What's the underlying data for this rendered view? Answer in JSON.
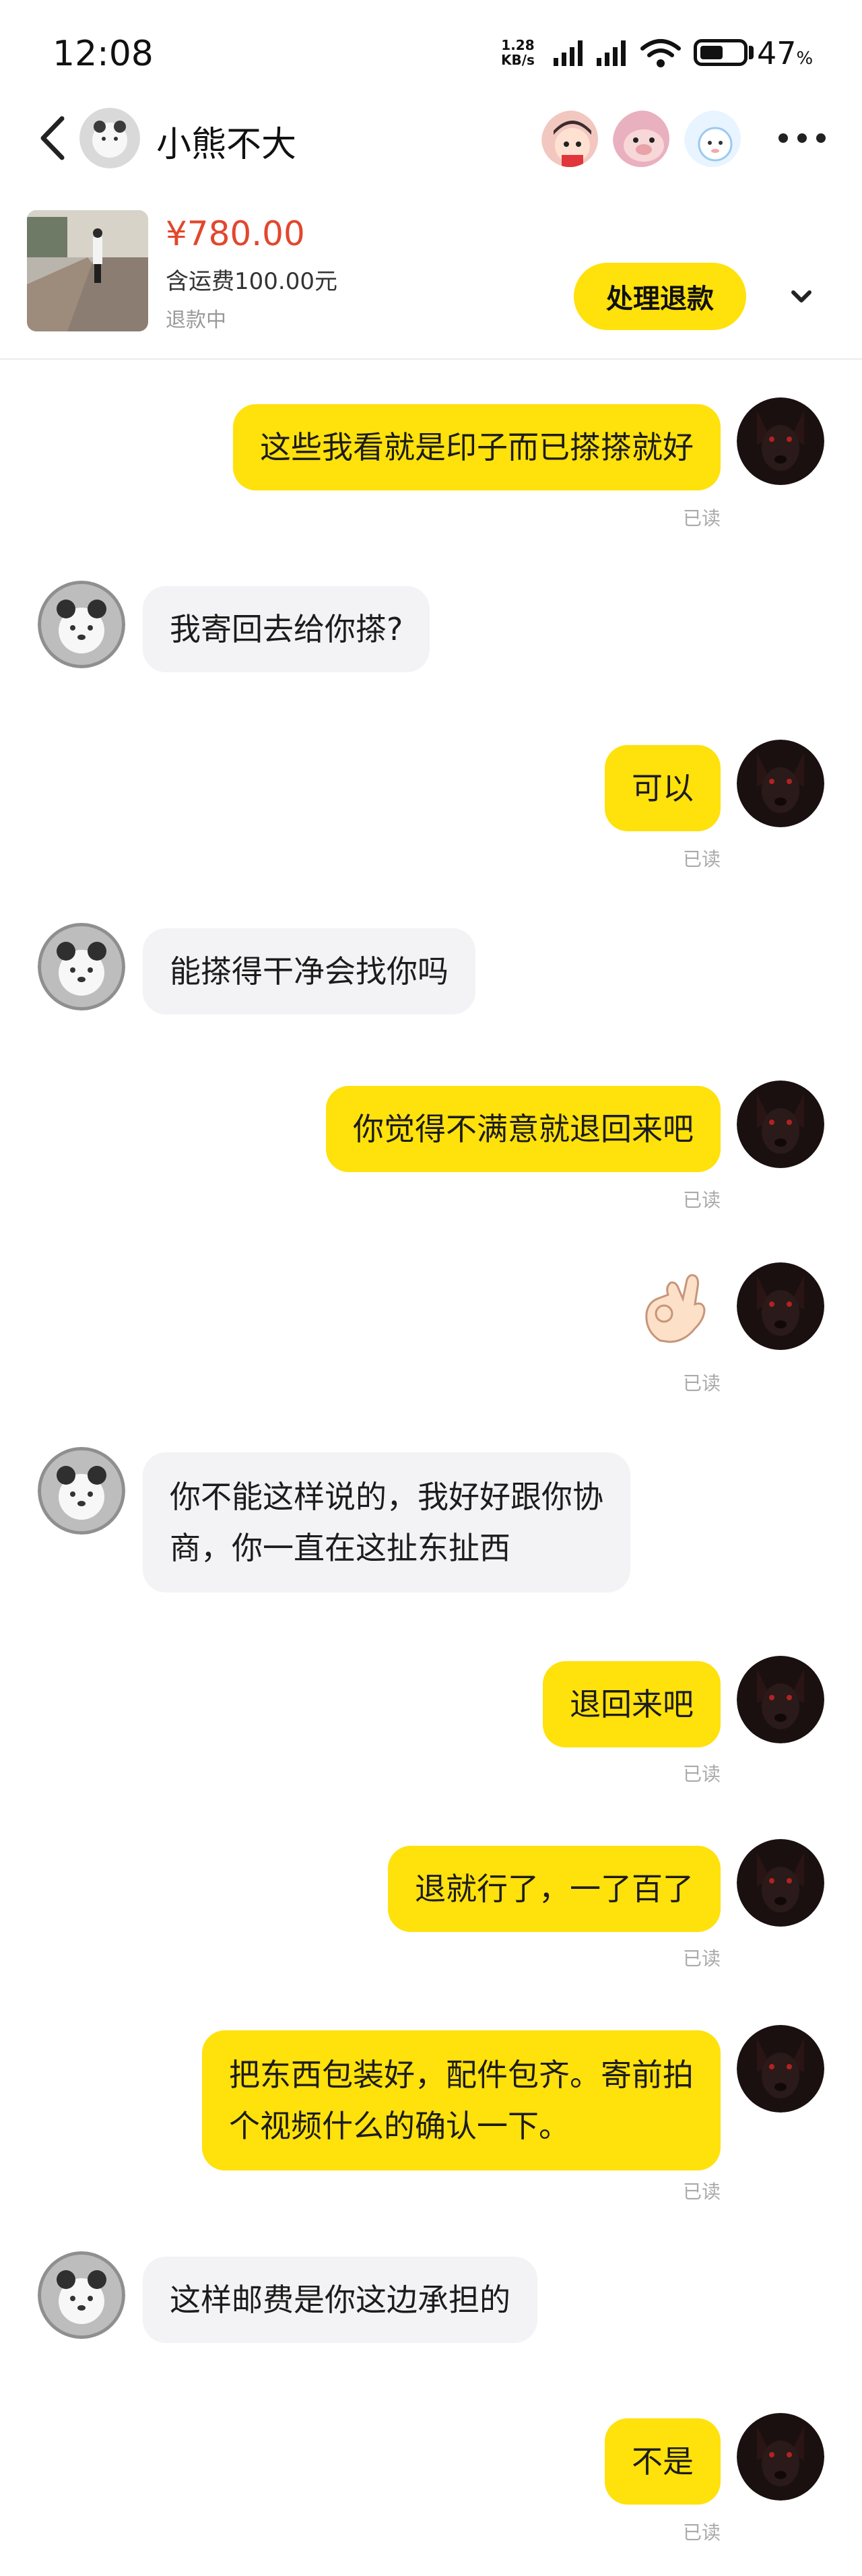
{
  "status_bar": {
    "time": "12:08",
    "net_speed_value": "1.28",
    "net_speed_unit": "KB/s",
    "battery_percent": "47",
    "battery_unit": "%",
    "battery_level": 0.47
  },
  "header": {
    "contact_name": "小熊不大",
    "icons": [
      "back-icon",
      "contact-avatar",
      "group-avatar",
      "more-icon"
    ]
  },
  "product": {
    "price": "¥780.00",
    "shipping": "含运费100.00元",
    "status": "退款中",
    "refund_button": "处理退款",
    "expand_icon": "chevron-down-icon"
  },
  "messages": {
    "m1": {
      "text": "这些我看就是印子而已搽搽就好",
      "read": "已读"
    },
    "m2": {
      "text": "我寄回去给你搽?"
    },
    "m3": {
      "text": "可以",
      "read": "已读"
    },
    "m4": {
      "text": "能搽得干净会找你吗"
    },
    "m5": {
      "text": "你觉得不满意就退回来吧",
      "read": "已读"
    },
    "m6": {
      "sticker": "ok-hand-emoji",
      "read": "已读"
    },
    "m7": {
      "line1": "你不能这样说的，我好好跟你协",
      "line2": "商，你一直在这扯东扯西"
    },
    "m8": {
      "text": "退回来吧",
      "read": "已读"
    },
    "m9": {
      "text": "退就行了，一了百了",
      "read": "已读"
    },
    "m10": {
      "line1": "把东西包装好，配件包齐。寄前拍",
      "line2": "个视频什么的确认一下。",
      "read": "已读"
    },
    "m11": {
      "text": "这样邮费是你这边承担的"
    },
    "m12": {
      "text": "不是",
      "read": "已读"
    }
  },
  "colors": {
    "accent_yellow": "#ffe10c",
    "price_red": "#e2472d",
    "incoming_bubble": "#f3f3f5",
    "muted_text": "#aaaaaa"
  }
}
